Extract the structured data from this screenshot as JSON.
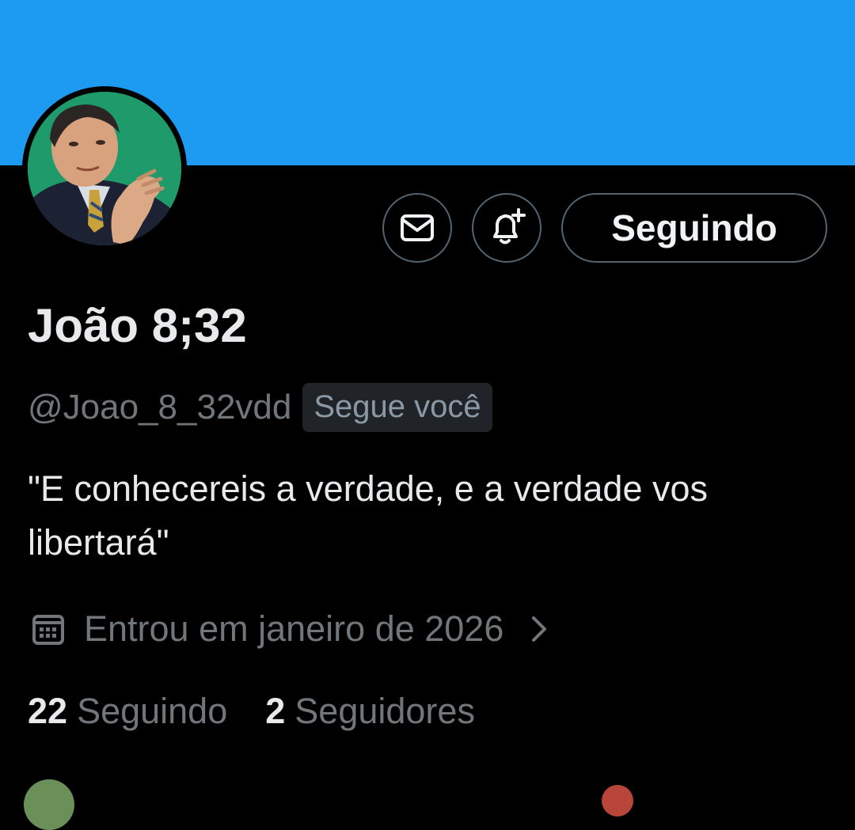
{
  "profile": {
    "banner_color": "#1d9bf0",
    "display_name": "João 8;32",
    "handle": "@Joao_8_32vdd",
    "follows_you_badge": "Segue você",
    "bio": "\"E conhecereis a verdade, e a verdade vos libertará\"",
    "joined": "Entrou em janeiro de 2026",
    "following_count": "22",
    "following_label": "Seguindo",
    "followers_count": "2",
    "followers_label": "Seguidores"
  },
  "actions": {
    "message_icon": "envelope-icon",
    "notify_icon": "bell-plus-icon",
    "follow_button_label": "Seguindo"
  },
  "icons": {
    "joined": "calendar-icon",
    "joined_chevron": "chevron-right-icon"
  }
}
